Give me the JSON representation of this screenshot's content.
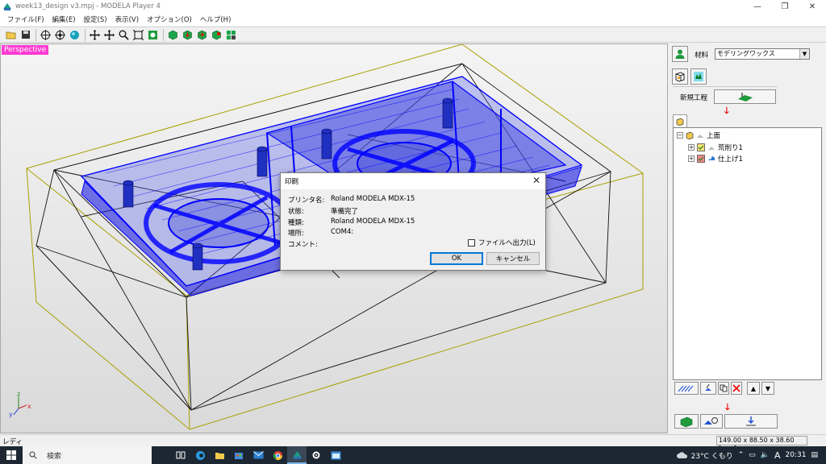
{
  "window": {
    "title": "week13_design v3.mpj - MODELA Player 4",
    "controls": [
      "—",
      "❐",
      "✕"
    ]
  },
  "menu": [
    "ファイル(F)",
    "編集(E)",
    "設定(S)",
    "表示(V)",
    "オプション(O)",
    "ヘルプ(H)"
  ],
  "viewport": {
    "label": "Perspective"
  },
  "dialog": {
    "title": "印刷",
    "close": "✕",
    "rows": [
      {
        "label": "プリンタ名:",
        "value": "Roland MODELA MDX-15"
      },
      {
        "label": "状態:",
        "value": "準備完了"
      },
      {
        "label": "種類:",
        "value": "Roland MODELA MDX-15"
      },
      {
        "label": "場所:",
        "value": "COM4:"
      },
      {
        "label": "コメント:",
        "value": ""
      }
    ],
    "file_output": "ファイルへ出力(L)",
    "ok": "OK",
    "cancel": "キャンセル"
  },
  "panel": {
    "material_label": "材料",
    "material_value": "モデリングワックス",
    "new_process_label": "新規工程",
    "tree": {
      "root": "上面",
      "items": [
        "荒削り1",
        "仕上げ1"
      ]
    }
  },
  "status": {
    "text": "レディ",
    "dimensions": "149.00 x 88.50 x 38.60 [mm]"
  },
  "taskbar": {
    "search_placeholder": "検索",
    "weather": "23°C くもり",
    "ime": "A",
    "time": "20:31"
  },
  "colors": {
    "accent_label": "#ff3bd1",
    "mesh": "#0000ff",
    "taskbar": "#1c2733"
  }
}
